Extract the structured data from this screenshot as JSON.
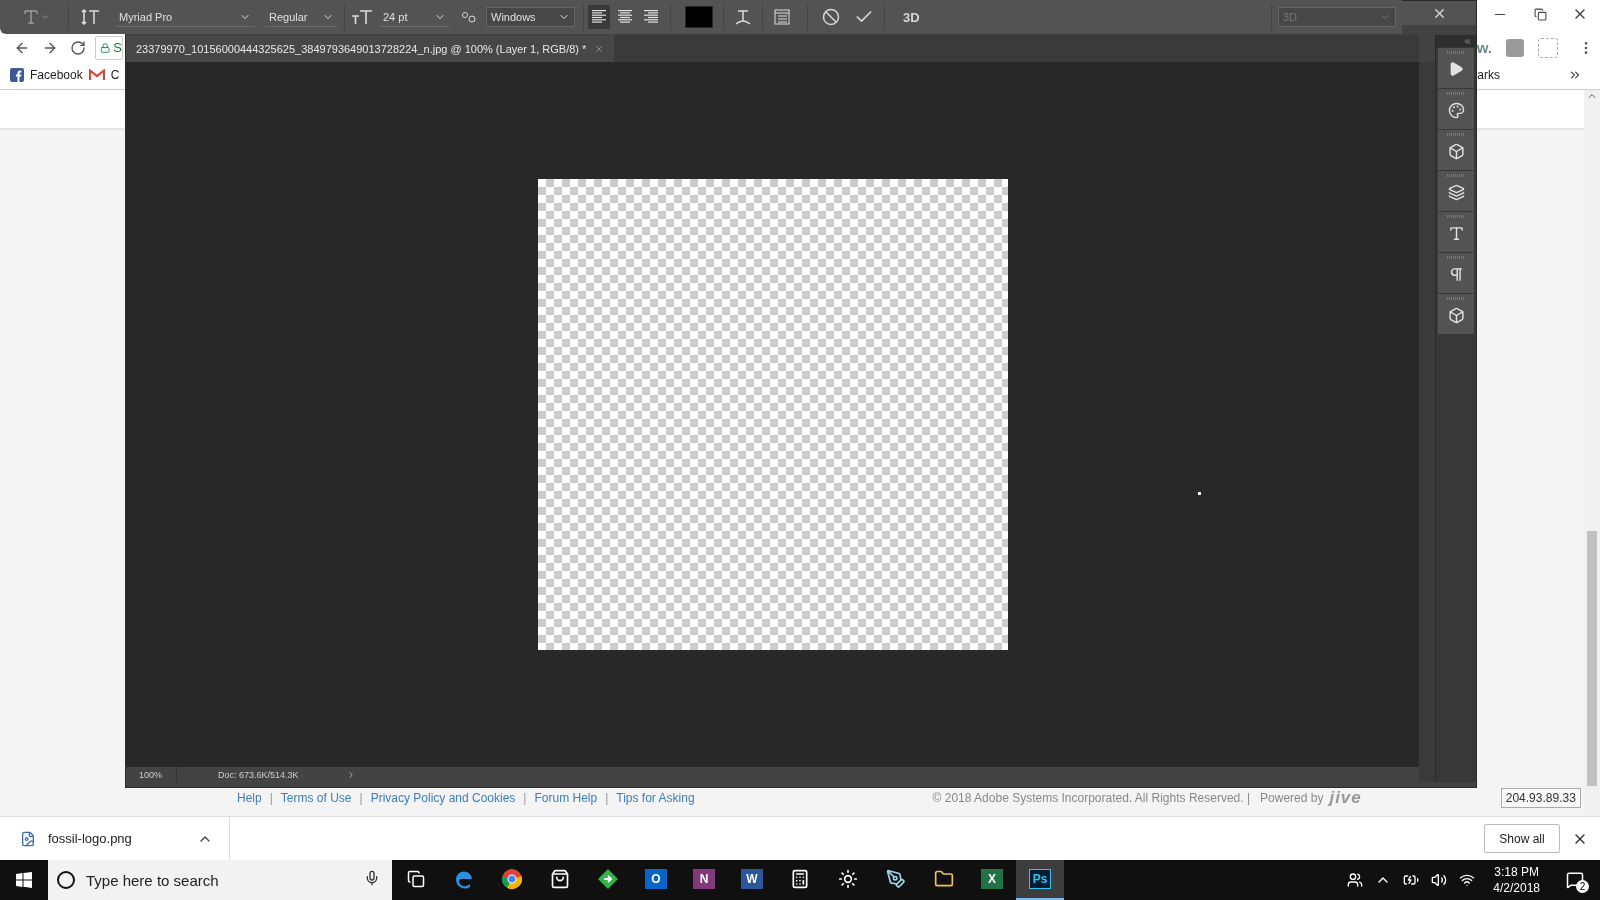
{
  "photoshop": {
    "options_bar": {
      "font_family": "Myriad Pro",
      "font_style": "Regular",
      "font_size": "24 pt",
      "anti_alias": "Windows",
      "align": [
        {
          "kind": "left",
          "selected": true
        },
        {
          "kind": "center",
          "selected": false
        },
        {
          "kind": "right",
          "selected": false
        }
      ],
      "three_d": "3D",
      "workspace": {
        "label": "3D",
        "disabled": true
      }
    },
    "document_tab": {
      "title": "23379970_10156000444325625_3849793649013728224_n.jpg @ 100% (Layer 1, RGB/8) *"
    },
    "status_bar": {
      "zoom": "100%",
      "doc_info": "Doc: 673.6K/514.3K"
    },
    "panel_dock": [
      {
        "kind": "play"
      },
      {
        "kind": "palette"
      },
      {
        "kind": "color"
      },
      {
        "kind": "layers"
      },
      {
        "kind": "character"
      },
      {
        "kind": "paragraph"
      },
      {
        "kind": "cube"
      }
    ]
  },
  "browser": {
    "address": "S",
    "extension_label": "w.",
    "bookmarks": [
      {
        "kind": "facebook",
        "label": "Facebook"
      },
      {
        "kind": "gmail"
      },
      {
        "kind": "plain",
        "label": "C"
      }
    ],
    "other_bookmarks": "arks",
    "footer": {
      "links": [
        {
          "label": "Help",
          "separator": "|"
        },
        {
          "label": "Terms of Use",
          "separator": "|"
        },
        {
          "label": "Privacy Policy and Cookies",
          "separator": "|"
        },
        {
          "label": "Forum Help",
          "separator": "|"
        },
        {
          "label": "Tips for Asking"
        }
      ],
      "copyright": "© 2018 Adobe Systems Incorporated. All Rights Reserved. |",
      "powered_by": "Powered by",
      "brand": "jive",
      "ip": "204.93.89.33"
    },
    "download": {
      "file": "fossil-logo.png",
      "show_all": "Show all"
    }
  },
  "taskbar": {
    "search_placeholder": "Type here to search",
    "apps": [
      {
        "kind": "edge",
        "selected": false
      },
      {
        "kind": "chrome",
        "selected": false
      },
      {
        "kind": "store",
        "selected": false
      },
      {
        "kind": "green",
        "selected": false
      },
      {
        "kind": "tile",
        "label": "O",
        "color": "#0a64c8",
        "selected": false
      },
      {
        "kind": "tile",
        "label": "N",
        "color": "#80397b",
        "selected": false
      },
      {
        "kind": "tile",
        "label": "W",
        "color": "#2b579a",
        "selected": false
      },
      {
        "kind": "calculator",
        "selected": false
      },
      {
        "kind": "sun",
        "selected": false
      },
      {
        "kind": "pen",
        "selected": false
      },
      {
        "kind": "folder",
        "selected": false
      },
      {
        "kind": "tile",
        "label": "X",
        "color": "#217346",
        "selected": false
      },
      {
        "kind": "tile",
        "label": "Ps",
        "color": "#001d34",
        "selected": true
      }
    ],
    "time": "3:18 PM",
    "date": "4/2/2018",
    "notifications": "2"
  }
}
